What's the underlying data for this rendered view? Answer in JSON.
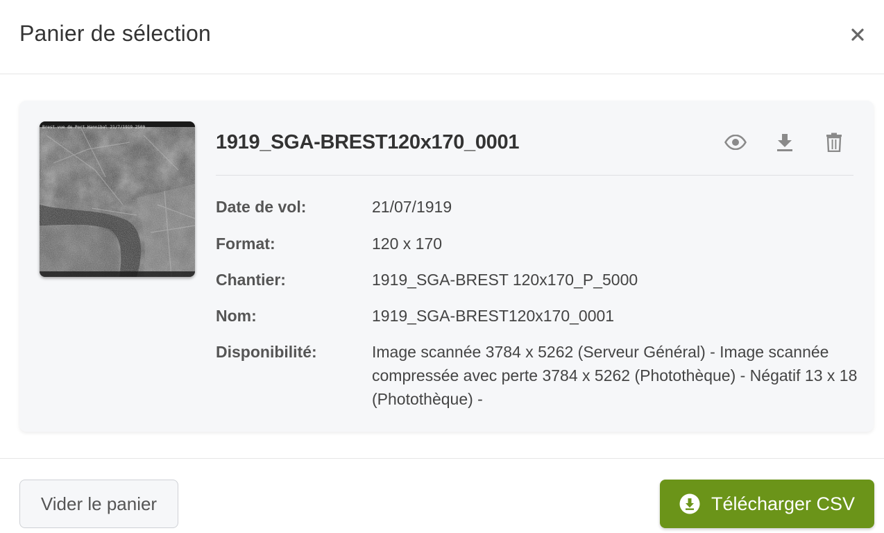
{
  "modal": {
    "title": "Panier de sélection",
    "close_icon": "close-icon"
  },
  "item": {
    "title": "1919_SGA-BREST120x170_0001",
    "thumbnail_icon": "aerial-photo-thumbnail",
    "thumbnail_caption": "Brest vue de Port Hannibal 21/7/1919 2500",
    "actions": [
      {
        "icon": "eye-icon",
        "purpose": "preview"
      },
      {
        "icon": "download-icon",
        "purpose": "download"
      },
      {
        "icon": "trash-icon",
        "purpose": "delete"
      }
    ],
    "details": {
      "date_label": "Date de vol:",
      "date_value": "21/07/1919",
      "format_label": "Format:",
      "format_value": "120 x 170",
      "chantier_label": "Chantier:",
      "chantier_value": "1919_SGA-BREST 120x170_P_5000",
      "nom_label": "Nom:",
      "nom_value": "1919_SGA-BREST120x170_0001",
      "dispo_label": "Disponibilité:",
      "dispo_value": "Image scannée 3784 x 5262 (Serveur Général) - Image scannée compressée avec perte 3784 x 5262 (Photothèque) - Négatif 13 x 18 (Photothèque) -"
    }
  },
  "footer": {
    "empty_label": "Vider le panier",
    "csv_label": "Télécharger CSV",
    "csv_icon": "download-circle-icon"
  },
  "colors": {
    "primary_green": "#6b9419",
    "card_bg": "#f6f7f9",
    "icon_gray": "#888888"
  }
}
